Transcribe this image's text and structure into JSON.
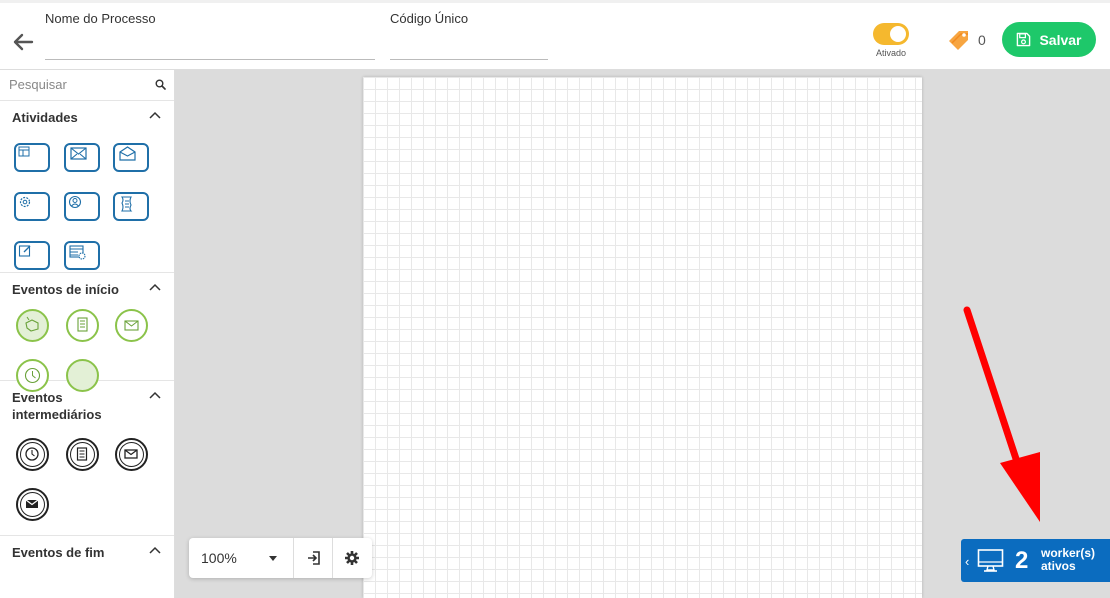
{
  "header": {
    "process_name_label": "Nome do Processo",
    "process_name_value": "",
    "unique_code_label": "Código Único",
    "unique_code_value": "",
    "toggle_label": "Ativado",
    "toggle_on": true,
    "tag_count": "0",
    "save_label": "Salvar",
    "accent_color": "#1ec86a",
    "toggle_color": "#f5b82e"
  },
  "sidebar": {
    "search_placeholder": "Pesquisar",
    "sections": [
      {
        "title": "Atividades",
        "items": [
          "table-task-icon",
          "send-message-task-icon",
          "receive-message-task-icon",
          "service-task-icon",
          "user-task-icon",
          "script-task-icon",
          "manual-task-icon",
          "business-rule-task-icon"
        ]
      },
      {
        "title": "Eventos de início",
        "items": [
          "manual-start-icon",
          "document-start-icon",
          "message-start-icon",
          "timer-start-icon",
          "none-start-icon"
        ]
      },
      {
        "title": "Eventos intermediários",
        "items": [
          "timer-intermediate-icon",
          "document-intermediate-icon",
          "message-intermediate-icon",
          "message-throw-intermediate-icon"
        ]
      },
      {
        "title": "Eventos de fim",
        "items": []
      }
    ],
    "activity_color": "#1f6fa8",
    "start_event_color": "#8bc34a"
  },
  "canvas": {
    "zoom_value": "100%"
  },
  "workers": {
    "count": "2",
    "label": "worker(s) ativos",
    "color": "#0b6cbf"
  },
  "annotation": {
    "arrow_color": "#ff0000"
  }
}
